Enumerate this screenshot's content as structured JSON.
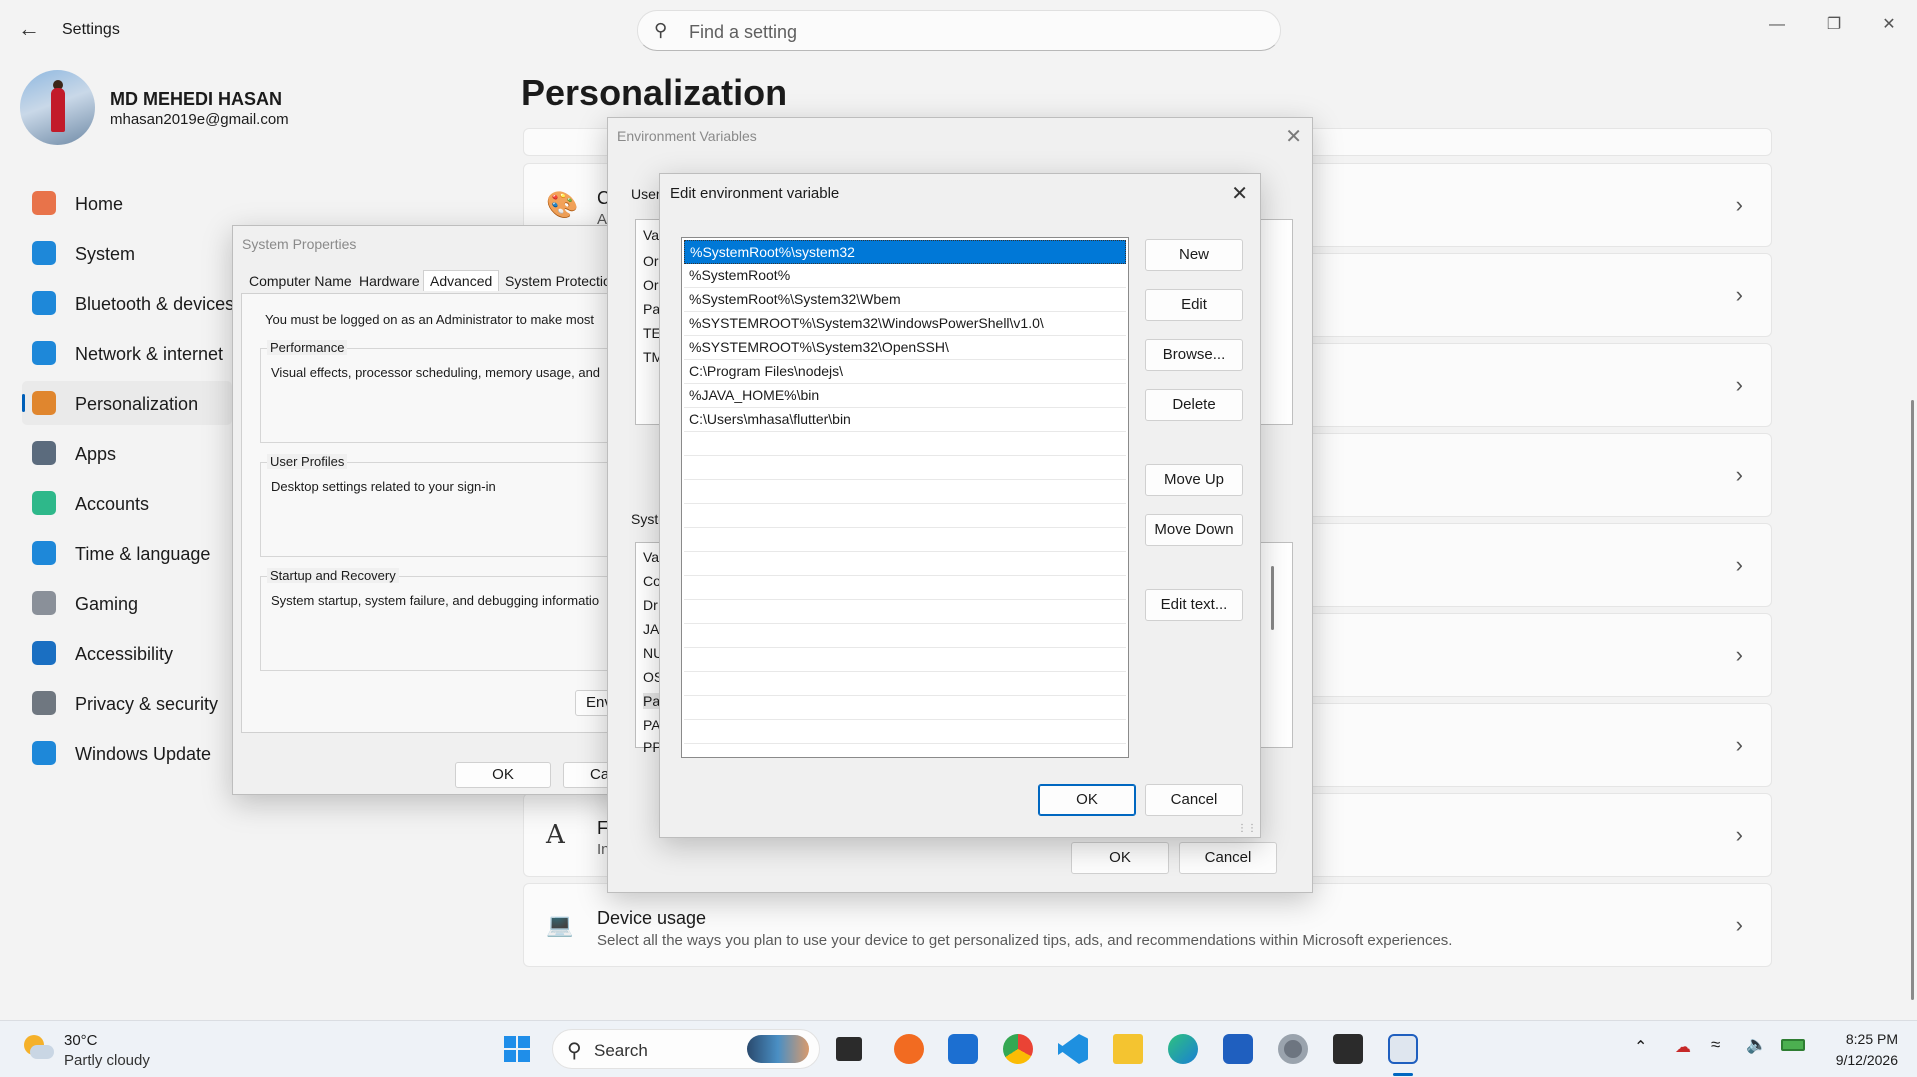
{
  "window": {
    "app_title": "Settings",
    "back_glyph": "←",
    "controls": {
      "minimize": "—",
      "maximize": "❐",
      "close": "✕"
    }
  },
  "search": {
    "placeholder": "Find a setting",
    "icon": "search-icon"
  },
  "profile": {
    "name": "MD MEHEDI HASAN",
    "email": "mhasan2019e@gmail.com"
  },
  "nav": [
    {
      "label": "Home",
      "icon": "home-icon",
      "color": "#e8734a"
    },
    {
      "label": "System",
      "icon": "monitor-icon",
      "color": "#1e88d9"
    },
    {
      "label": "Bluetooth & devices",
      "icon": "bluetooth-icon",
      "color": "#1e88d9"
    },
    {
      "label": "Network & internet",
      "icon": "wifi-icon",
      "color": "#1e88d9"
    },
    {
      "label": "Personalization",
      "icon": "brush-icon",
      "color": "#e0862e",
      "active": true
    },
    {
      "label": "Apps",
      "icon": "apps-icon",
      "color": "#5b6b7d"
    },
    {
      "label": "Accounts",
      "icon": "person-icon",
      "color": "#2eb88a"
    },
    {
      "label": "Time & language",
      "icon": "clock-globe-icon",
      "color": "#1e88d9"
    },
    {
      "label": "Gaming",
      "icon": "gamepad-icon",
      "color": "#8a9099"
    },
    {
      "label": "Accessibility",
      "icon": "accessibility-icon",
      "color": "#1a6fc2"
    },
    {
      "label": "Privacy & security",
      "icon": "shield-icon",
      "color": "#6f7780"
    },
    {
      "label": "Windows Update",
      "icon": "update-icon",
      "color": "#1e88d9"
    }
  ],
  "page_title": "Personalization",
  "cards": {
    "colors_title_fragment": "C",
    "colors_sub_fragment": "A",
    "fonts_title_fragment": "F",
    "fonts_sub_fragment": "In",
    "device_usage_title": "Device usage",
    "device_usage_sub": "Select all the ways you plan to use your device to get personalized tips, ads, and recommendations within Microsoft experiences."
  },
  "system_properties": {
    "title": "System Properties",
    "tabs": [
      "Computer Name",
      "Hardware",
      "Advanced",
      "System Protection"
    ],
    "admin_note": "You must be logged on as an Administrator to make most",
    "groups": [
      {
        "title": "Performance",
        "desc": "Visual effects, processor scheduling, memory usage, and"
      },
      {
        "title": "User Profiles",
        "desc": "Desktop settings related to your sign-in"
      },
      {
        "title": "Startup and Recovery",
        "desc": "System startup, system failure, and debugging informatio"
      }
    ],
    "env_button": "Env",
    "ok": "OK",
    "cancel": "Ca"
  },
  "environment_variables": {
    "title": "Environment Variables",
    "user_label": "User",
    "user_rows": [
      "Va",
      "Or",
      "Or",
      "Pa",
      "TE",
      "TM"
    ],
    "system_label": "Syste",
    "system_rows": [
      "Va",
      "Co",
      "Dr",
      "JA",
      "NU",
      "OS",
      "Pa",
      "PA",
      "PP"
    ],
    "ok": "OK",
    "cancel": "Cancel"
  },
  "edit_env": {
    "title": "Edit environment variable",
    "paths": [
      "%SystemRoot%\\system32",
      "%SystemRoot%",
      "%SystemRoot%\\System32\\Wbem",
      "%SYSTEMROOT%\\System32\\WindowsPowerShell\\v1.0\\",
      "%SYSTEMROOT%\\System32\\OpenSSH\\",
      "C:\\Program Files\\nodejs\\",
      "%JAVA_HOME%\\bin",
      "C:\\Users\\mhasa\\flutter\\bin"
    ],
    "buttons": {
      "new": "New",
      "edit": "Edit",
      "browse": "Browse...",
      "delete": "Delete",
      "move_up": "Move Up",
      "move_down": "Move Down",
      "edit_text": "Edit text..."
    },
    "ok": "OK",
    "cancel": "Cancel"
  },
  "taskbar": {
    "weather_temp": "30°C",
    "weather_desc": "Partly cloudy",
    "search_label": "Search",
    "time": "8:25 PM",
    "date": "9/12/2026"
  }
}
